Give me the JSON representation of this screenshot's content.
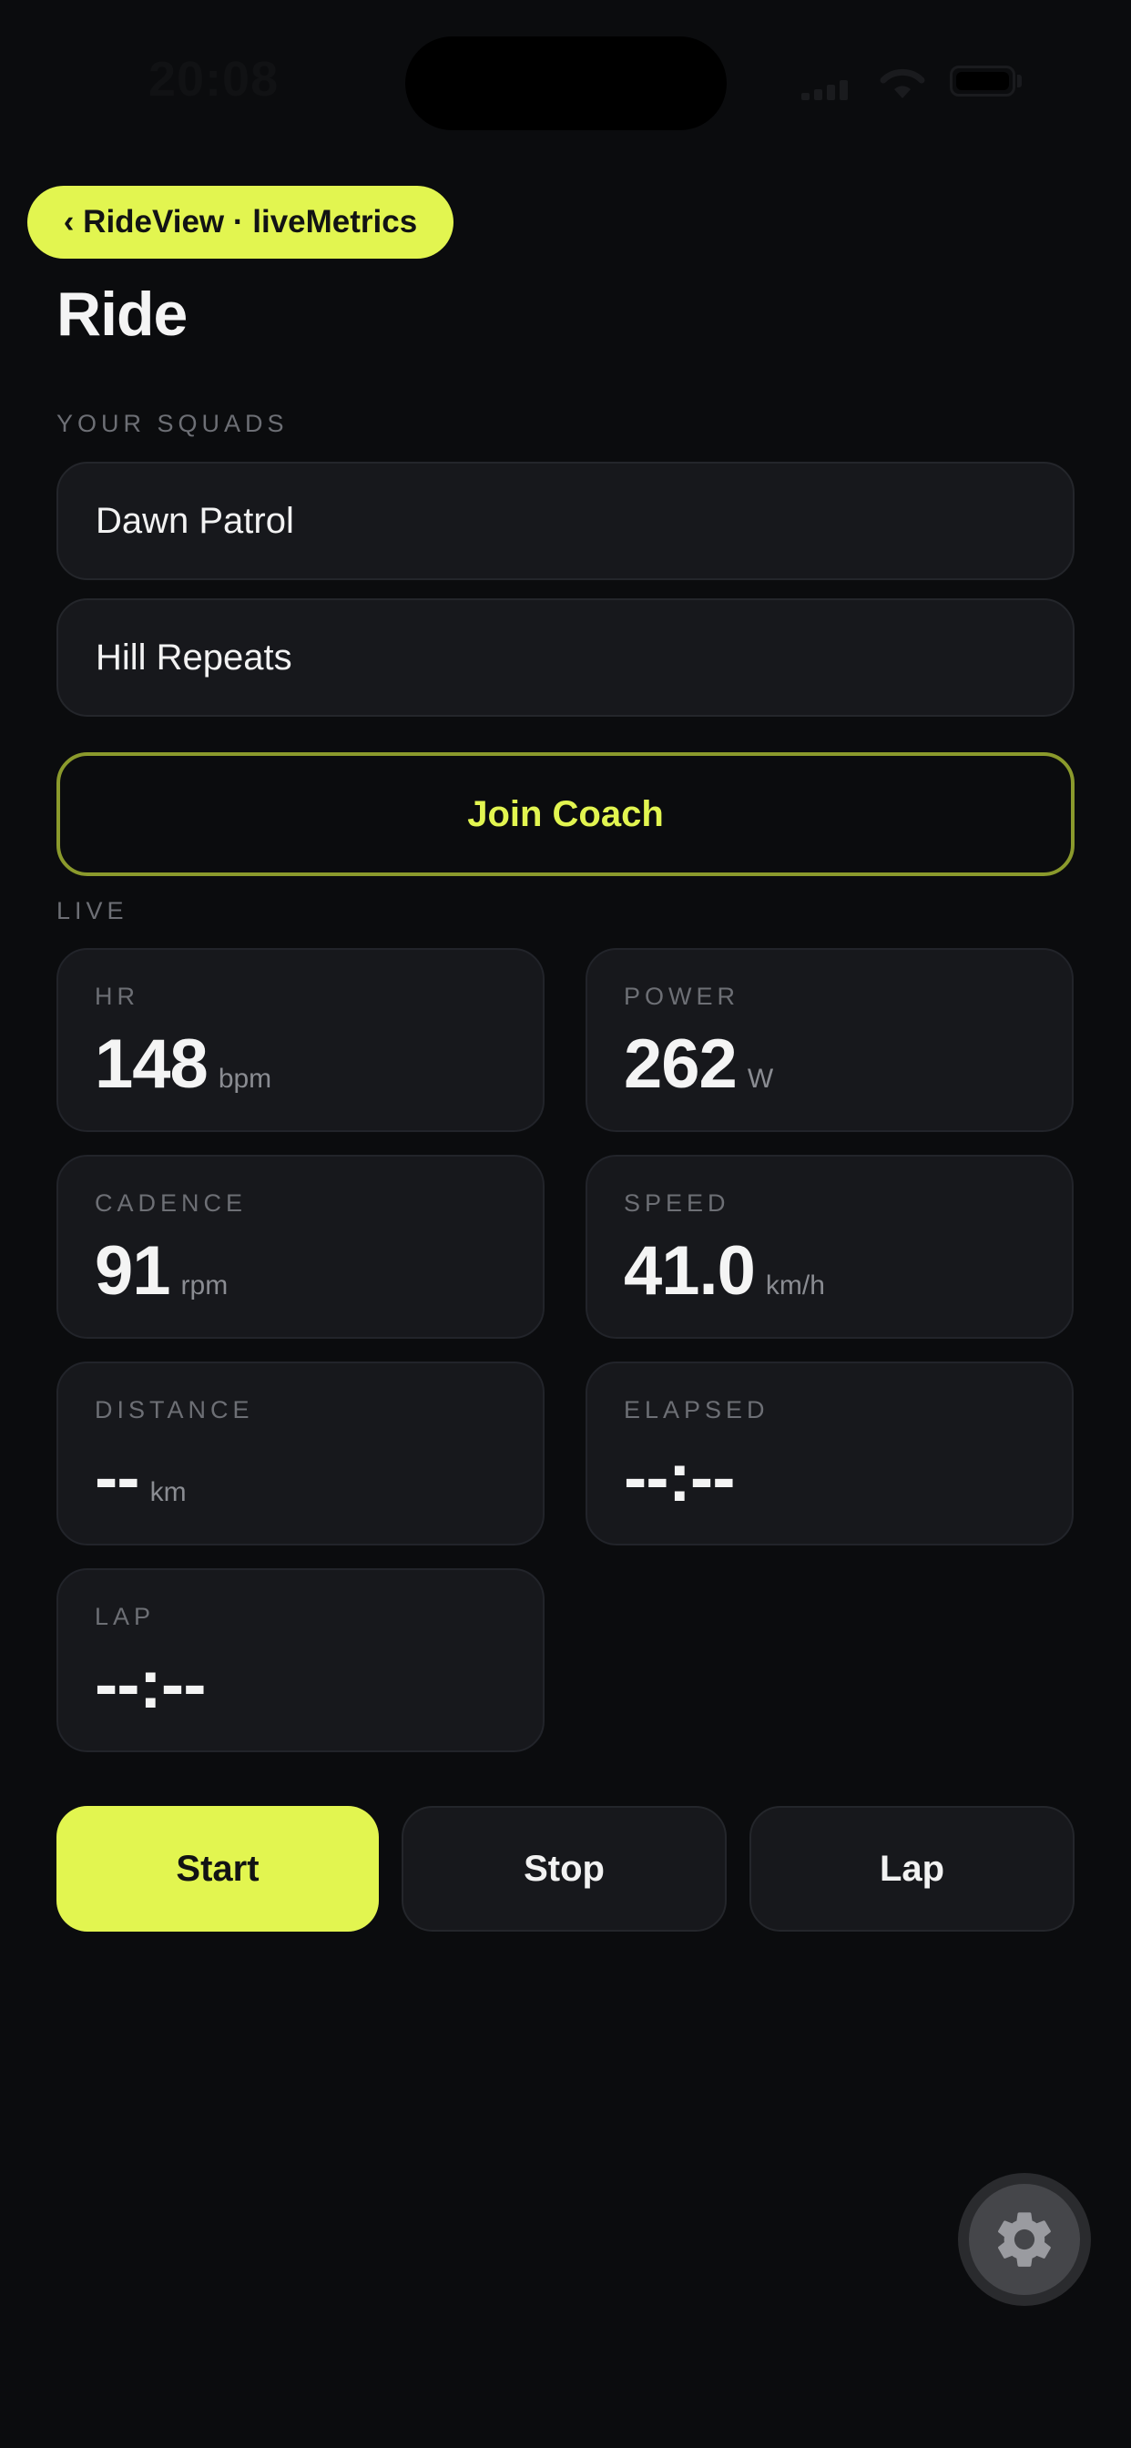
{
  "status_bar": {
    "time": "20:08"
  },
  "debug_pill": {
    "label": "‹ RideView · liveMetrics"
  },
  "page": {
    "title": "Ride"
  },
  "squads": {
    "section_label": "YOUR SQUADS",
    "items": [
      {
        "label": "Dawn Patrol"
      },
      {
        "label": "Hill Repeats"
      }
    ]
  },
  "join_coach": {
    "label": "Join Coach"
  },
  "live": {
    "section_label": "LIVE",
    "metrics": [
      {
        "label": "HR",
        "value": "148",
        "unit": "bpm"
      },
      {
        "label": "POWER",
        "value": "262",
        "unit": "W"
      },
      {
        "label": "CADENCE",
        "value": "91",
        "unit": "rpm"
      },
      {
        "label": "SPEED",
        "value": "41.0",
        "unit": "km/h"
      },
      {
        "label": "DISTANCE",
        "value": "--",
        "unit": "km"
      },
      {
        "label": "ELAPSED",
        "value": "--:--",
        "unit": ""
      },
      {
        "label": "LAP",
        "value": "--:--",
        "unit": ""
      }
    ]
  },
  "controls": {
    "start_label": "Start",
    "stop_label": "Stop",
    "lap_label": "Lap"
  },
  "settings": {
    "icon": "gear-icon"
  },
  "colors": {
    "background": "#0b0c0e",
    "accent": "#e2f550",
    "card": "#17181c",
    "muted_text": "#6d6f75"
  }
}
